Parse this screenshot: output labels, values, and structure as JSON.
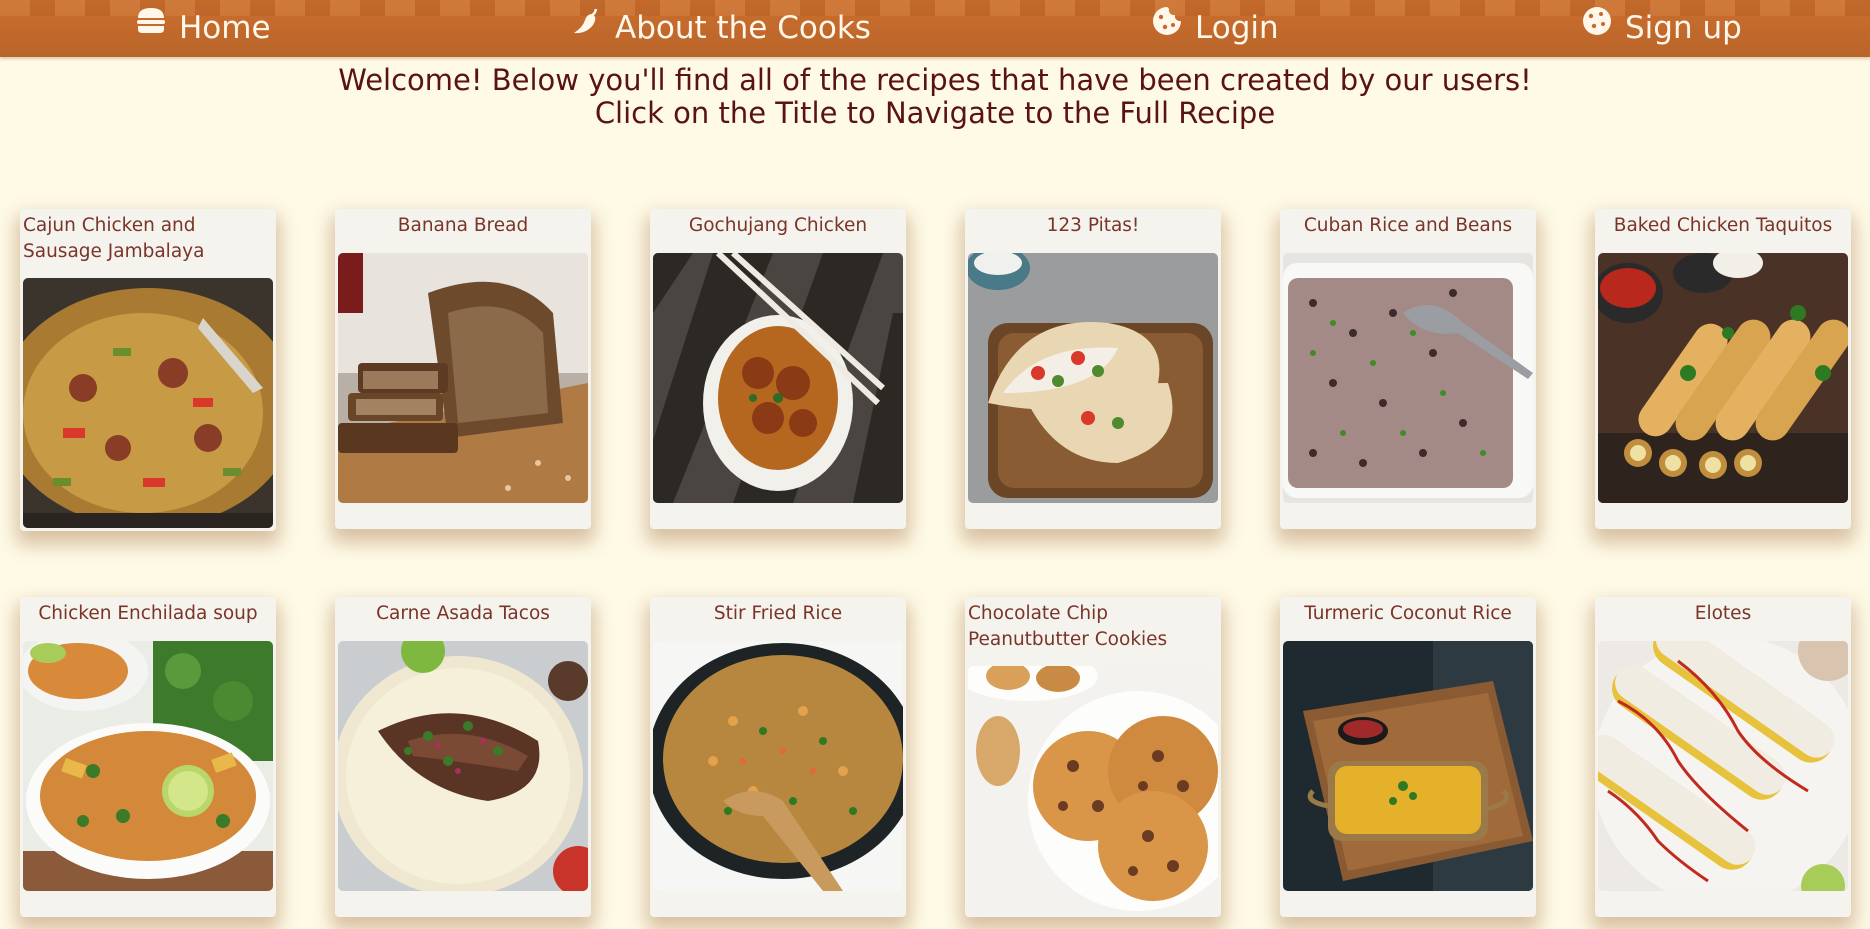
{
  "nav": {
    "home": {
      "label": "Home",
      "icon": "burger-icon"
    },
    "about": {
      "label": "About the Cooks",
      "icon": "chili-pepper-icon"
    },
    "login": {
      "label": "Login",
      "icon": "cookie-icon"
    },
    "signup": {
      "label": "Sign up",
      "icon": "cookie-icon"
    }
  },
  "welcome": {
    "line1": "Welcome! Below you'll find all of the recipes that have been created by our users!",
    "line2": "Click on the Title to Navigate to the Full Recipe"
  },
  "recipes": [
    {
      "title": "Cajun Chicken and Sausage Jambalaya"
    },
    {
      "title": "Banana Bread"
    },
    {
      "title": "Gochujang Chicken"
    },
    {
      "title": "123 Pitas!"
    },
    {
      "title": "Cuban Rice and Beans"
    },
    {
      "title": "Baked Chicken Taquitos"
    },
    {
      "title": "Chicken Enchilada soup"
    },
    {
      "title": "Carne Asada Tacos"
    },
    {
      "title": "Stir Fried Rice"
    },
    {
      "title": "Chocolate Chip Peanutbutter Cookies"
    },
    {
      "title": "Turmeric Coconut Rice"
    },
    {
      "title": "Elotes"
    }
  ],
  "colors": {
    "navbar": "#c46a2c",
    "background": "#fefae6",
    "welcome_text": "#5a1212",
    "card_title": "#7a3428",
    "card_bg": "#f5f3ee"
  }
}
